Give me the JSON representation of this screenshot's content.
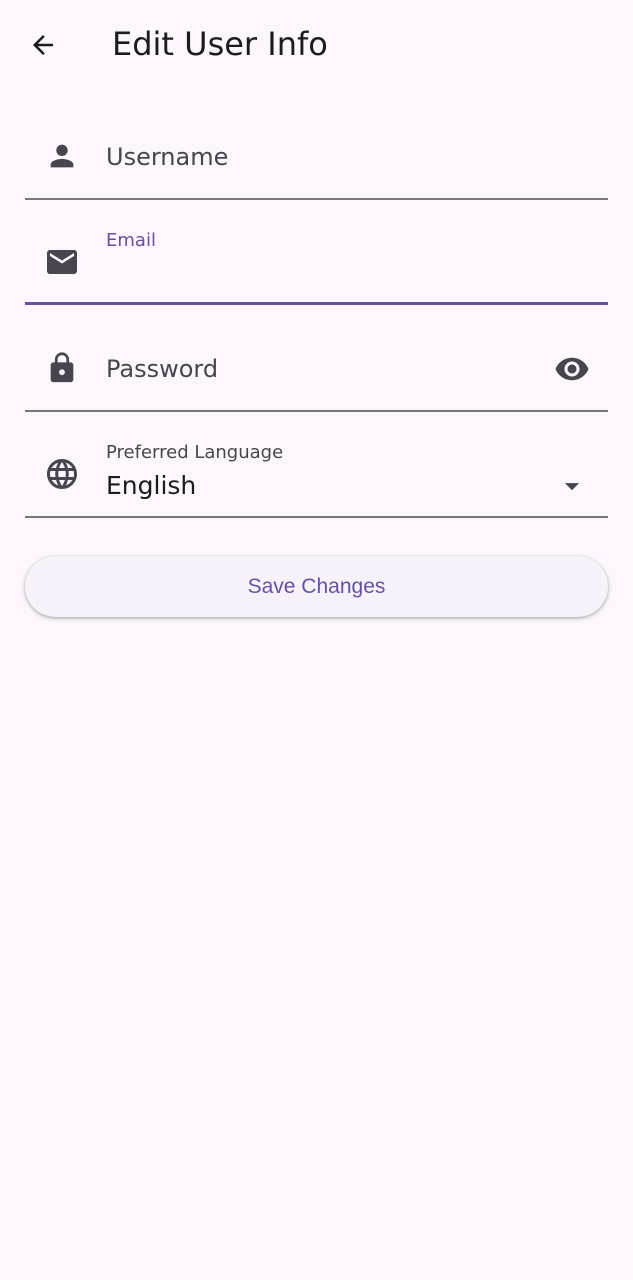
{
  "app_bar": {
    "title": "Edit User Info",
    "back_icon": "arrow-back-icon"
  },
  "form": {
    "username": {
      "placeholder": "Username",
      "icon": "person-icon"
    },
    "email": {
      "label": "Email",
      "value": "",
      "icon": "mail-icon",
      "focused": true
    },
    "password": {
      "placeholder": "Password",
      "icon": "lock-icon",
      "toggle_icon": "eye-icon"
    },
    "language": {
      "label": "Preferred Language",
      "value": "English",
      "icon": "globe-icon",
      "dropdown_icon": "arrow-drop-down-icon"
    }
  },
  "actions": {
    "save_label": "Save Changes"
  },
  "colors": {
    "background": "#fdf7fd",
    "primary": "#6750a4",
    "outline": "#79747e",
    "on_surface": "#1d1b20",
    "icon": "#49454f"
  }
}
